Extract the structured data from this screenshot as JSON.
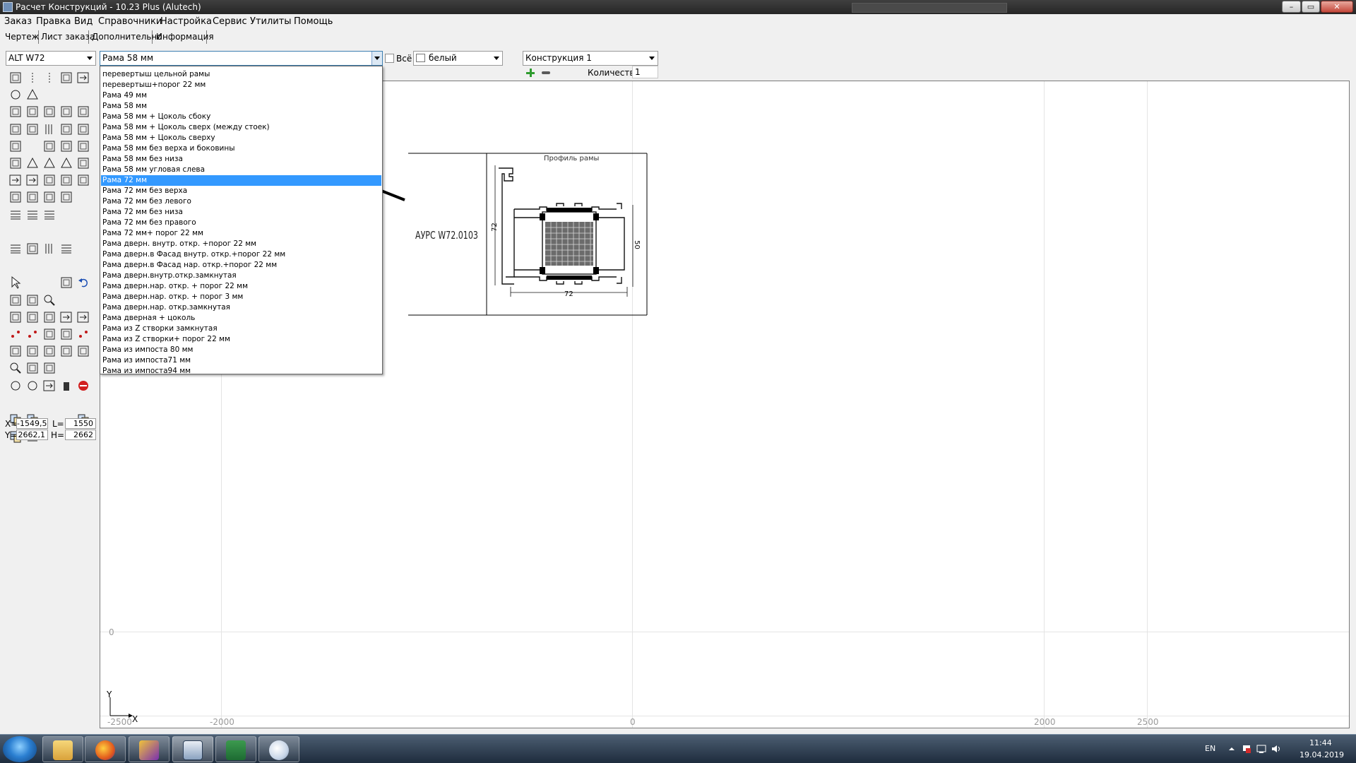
{
  "window": {
    "title": "Расчет Конструкций - 10.23 Plus (Alutech)",
    "controls": [
      "–",
      "▭",
      "✕"
    ]
  },
  "menu": [
    "Заказ",
    "Правка",
    "Вид",
    "Справочники",
    "Настройка",
    "Сервис",
    "Утилиты",
    "Помощь"
  ],
  "tabs": [
    "Чертеж",
    "Лист заказа",
    "Дополнительно",
    "Информация"
  ],
  "toolbar": {
    "system_combo": "ALT W72",
    "profile_combo": "Рама 58 мм",
    "all_checkbox_label": "Всё",
    "all_checked": false,
    "color_combo": "белый",
    "construction_combo": "Конструкция 1",
    "quantity_label": "Количество",
    "quantity_value": "1"
  },
  "profile_dropdown": {
    "selected_index": 10,
    "items": [
      "перевертыш цельной рамы",
      "перевертыш+порог 22 мм",
      "Рама 49 мм",
      "Рама 58 мм",
      "Рама 58 мм + Цоколь сбоку",
      "Рама 58 мм + Цоколь сверх (между стоек)",
      "Рама 58 мм + Цоколь сверху",
      "Рама 58 мм без верха и боковины",
      "Рама 58 мм без низа",
      "Рама 58 мм угловая слева",
      "Рама 72 мм",
      "Рама 72 мм без верха",
      "Рама 72 мм без левого",
      "Рама 72 мм без низа",
      "Рама 72 мм без правого",
      "Рама 72 мм+ порог 22 мм",
      "Рама дверн. внутр. откр. +порог 22 мм",
      "Рама дверн.в Фасад внутр. откр.+порог 22 мм",
      "Рама дверн.в Фасад нар. откр.+порог 22 мм",
      "Рама дверн.внутр.откр.замкнутая",
      "Рама дверн.нар. откр. + порог 22 мм",
      "Рама дверн.нар. откр. + порог 3 мм",
      "Рама дверн.нар. откр.замкнутая",
      "Рама дверная + цоколь",
      "Рама из Z створки замкнутая",
      "Рама из Z створки+ порог 22 мм",
      "Рама из импоста 80 мм",
      "Рама из импоста71 мм",
      "Рама из импоста94 мм"
    ]
  },
  "profile_preview": {
    "article": "АУРС W72.0103",
    "caption": "Профиль рамы",
    "dim_width": "72",
    "dim_height": "72",
    "dim_inner": "50"
  },
  "coordinates": {
    "x_label": "X=",
    "x_value": "-1549,5",
    "y_label": "Y=",
    "y_value": "2662,1",
    "l_label": "L=",
    "l_value": "1550",
    "h_label": "H=",
    "h_value": "2662"
  },
  "canvas": {
    "axis_x_labels": [
      "-2500",
      "-2000",
      "0",
      "2000",
      "2500"
    ],
    "axis_y_labels": [
      "0"
    ],
    "origin_x_letter": "X",
    "origin_y_letter": "Y"
  },
  "taskbar": {
    "language": "EN",
    "time": "11:44",
    "date": "19.04.2019",
    "apps": [
      "explorer-icon",
      "firefox-icon",
      "calc-app-icon",
      "construction-app-icon",
      "excel-icon",
      "paint-icon"
    ]
  }
}
